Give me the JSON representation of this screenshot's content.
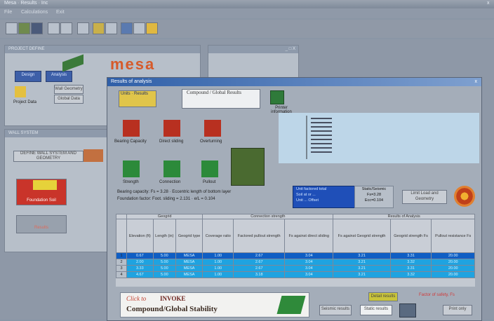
{
  "app": {
    "title": "Mesa · Results · Inc",
    "close": "x"
  },
  "menu": [
    "File",
    "Calculations",
    "Exit"
  ],
  "project_panel": {
    "title": "PROJECT DEFINE",
    "design": "Design",
    "analysis": "Analysis",
    "project_data": "Project Data",
    "wall_geometry": "Wall Geometry",
    "global_data": "Global Data",
    "logo": "mesa"
  },
  "small_window": {
    "title": "",
    "min": "_",
    "max": "□",
    "close": "X"
  },
  "wall_panel": {
    "title": "WALL SYSTEM",
    "wall_text": "DEFINE WALL SYSTEM AND GEOMETRY",
    "foundation_label": "Foundation Soil",
    "results_label": "Results"
  },
  "dialog": {
    "title": "Results of analysis",
    "close": "x",
    "tab_label": "Units · Results",
    "compound_label": "Compound / Global Results",
    "printer_label": "Printer information",
    "icons": [
      {
        "label": "Bearing Capacity"
      },
      {
        "label": "Direct sliding"
      },
      {
        "label": "Overturning"
      },
      {
        "label": "Pullout"
      },
      {
        "label": "Connection"
      },
      {
        "label": "Strength"
      }
    ],
    "bearing_text": "Bearing capacity: Fs = 3.28  ·  Eccentric length of bottom layer",
    "foundation_text": "Foundation factor: Foot. sliding = 2.131  ·  e/L = 0.104",
    "design_box": {
      "line1": "Unit factored total",
      "line2": "Soil at or ...",
      "line3": "Unit ... Offset"
    },
    "static": {
      "line1": "Static/Seismic",
      "line2": "Fs=3.28",
      "line3": "Ecc=0.104"
    },
    "limit_btn": "Limit Load and Geometry",
    "table": {
      "group_headers": [
        "Geogrid",
        "Connection strength",
        "Results of Analysis"
      ],
      "columns": [
        "Elevation (ft)",
        "Length (in)",
        "Geogrid type",
        "Coverage ratio",
        "Factored pullout strength",
        "Fs against direct sliding",
        "Fs against Geogrid strength",
        "Geogrid strength Fs",
        "Pullout resistance Fs"
      ],
      "rows": [
        {
          "n": "1",
          "cells": [
            "0.67",
            "5.00",
            "MESA",
            "1.00",
            "2.67",
            "3.04",
            "3.21",
            "3.31",
            "20.00"
          ]
        },
        {
          "n": "2",
          "cells": [
            "2.00",
            "5.00",
            "MESA",
            "1.00",
            "2.67",
            "3.04",
            "3.21",
            "3.32",
            "20.00"
          ]
        },
        {
          "n": "3",
          "cells": [
            "3.33",
            "5.00",
            "MESA",
            "1.00",
            "2.67",
            "3.04",
            "3.21",
            "3.31",
            "20.00"
          ]
        },
        {
          "n": "4",
          "cells": [
            "4.67",
            "5.00",
            "MESA",
            "1.00",
            "3.18",
            "3.04",
            "3.21",
            "3.32",
            "20.00"
          ]
        }
      ]
    },
    "banner": {
      "click_text": "Click to",
      "invoke": "INVOKE",
      "subtitle": "Compound/Global Stability"
    },
    "bottom": {
      "detail_results": "Detail results",
      "seismic_results": "Seismic results",
      "static_results": "Static results",
      "print": "Print only",
      "safety_label": "Factor of safety, Fs"
    }
  }
}
